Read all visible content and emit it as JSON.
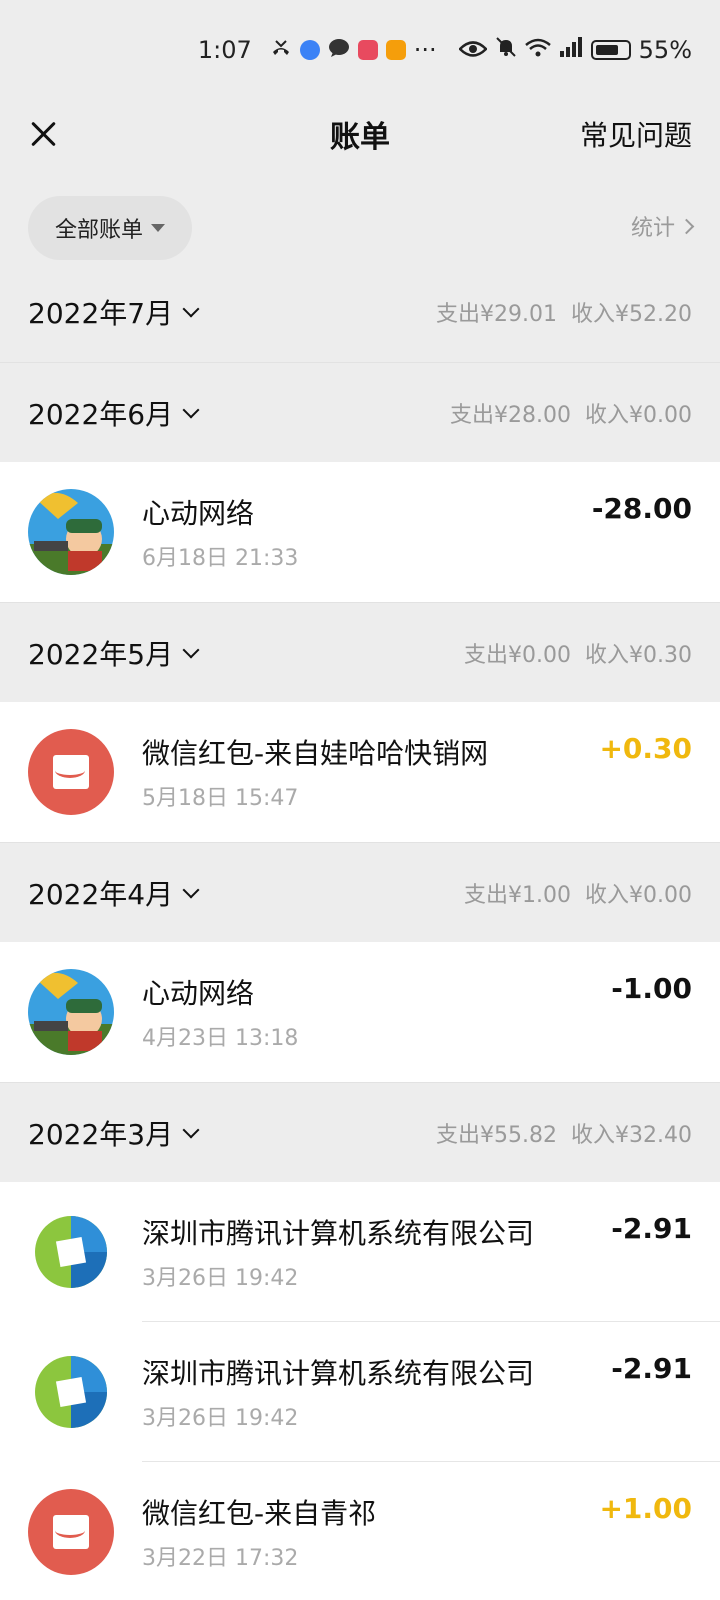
{
  "status_bar": {
    "time": "1:07",
    "battery": "55%",
    "icons": [
      "missed-call-icon",
      "browser-icon",
      "chat-icon",
      "reader-icon",
      "video-icon",
      "more-icon",
      "eye-icon",
      "mute-icon",
      "wifi-icon",
      "signal-icon",
      "battery-icon"
    ],
    "more": "···"
  },
  "header": {
    "title": "账单",
    "faq": "常见问题"
  },
  "filter": {
    "all_bills": "全部账单",
    "stats": "统计"
  },
  "colors": {
    "income": "#f0b80e",
    "red_packet": "#e15c4f",
    "background": "#ededed"
  },
  "months": [
    {
      "label": "2022年7月",
      "expense": "支出¥29.01",
      "income": "收入¥52.20"
    },
    {
      "label": "2022年6月",
      "expense": "支出¥28.00",
      "income": "收入¥0.00"
    },
    {
      "label": "2022年5月",
      "expense": "支出¥0.00",
      "income": "收入¥0.30"
    },
    {
      "label": "2022年4月",
      "expense": "支出¥1.00",
      "income": "收入¥0.00"
    },
    {
      "label": "2022年3月",
      "expense": "支出¥55.82",
      "income": "收入¥32.40"
    }
  ],
  "transactions": [
    {
      "name": "心动网络",
      "time": "6月18日 21:33",
      "amount": "-28.00",
      "icon": "game-avatar-icon"
    },
    {
      "name": "微信红包-来自娃哈哈快销网",
      "time": "5月18日 15:47",
      "amount": "+0.30",
      "icon": "red-packet-icon"
    },
    {
      "name": "心动网络",
      "time": "4月23日 13:18",
      "amount": "-1.00",
      "icon": "game-avatar-icon"
    },
    {
      "name": "深圳市腾讯计算机系统有限公司",
      "time": "3月26日 19:42",
      "amount": "-2.91",
      "icon": "tencent-logo-icon"
    },
    {
      "name": "深圳市腾讯计算机系统有限公司",
      "time": "3月26日 19:42",
      "amount": "-2.91",
      "icon": "tencent-logo-icon"
    },
    {
      "name": "微信红包-来自青祁",
      "time": "3月22日 17:32",
      "amount": "+1.00",
      "icon": "red-packet-icon"
    }
  ]
}
